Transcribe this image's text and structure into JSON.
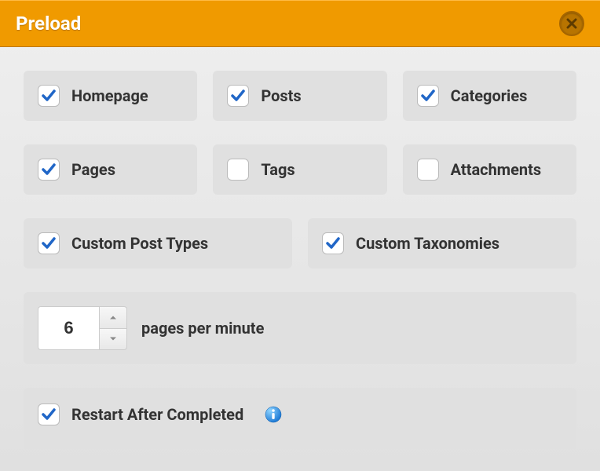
{
  "header": {
    "title": "Preload"
  },
  "options": {
    "homepage": {
      "label": "Homepage",
      "checked": true
    },
    "posts": {
      "label": "Posts",
      "checked": true
    },
    "categories": {
      "label": "Categories",
      "checked": true
    },
    "pages": {
      "label": "Pages",
      "checked": true
    },
    "tags": {
      "label": "Tags",
      "checked": false
    },
    "attachments": {
      "label": "Attachments",
      "checked": false
    },
    "custom_post_types": {
      "label": "Custom Post Types",
      "checked": true
    },
    "custom_taxonomies": {
      "label": "Custom Taxonomies",
      "checked": true
    }
  },
  "rate": {
    "value": "6",
    "label": "pages per minute"
  },
  "restart": {
    "label": "Restart After Completed",
    "checked": true
  },
  "colors": {
    "accent": "#f09a00",
    "check": "#2066c7"
  }
}
